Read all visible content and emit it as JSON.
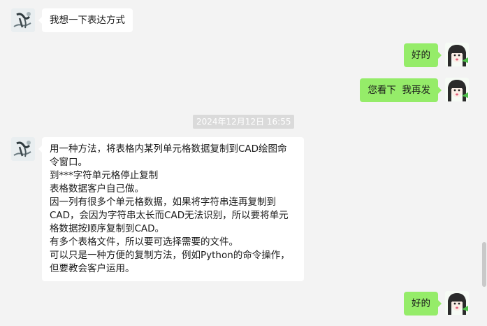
{
  "messages": [
    {
      "side": "in",
      "text": "我想一下表达方式"
    },
    {
      "side": "out",
      "text": "好的"
    },
    {
      "side": "out",
      "text": "您看下  我再发"
    },
    {
      "side": "in",
      "lines": [
        "用一种方法，将表格内某列单元格数据复制到CAD绘图命",
        "令窗口。",
        "到***字符单元格停止复制",
        "表格数据客户自己做。",
        "因一列有很多个单元格数据，如果将字符串连再复制到",
        "CAD，会因为字符串太长而CAD无法识别，所以要将单元",
        "格数据按顺序复制到CAD。",
        "有多个表格文件，所以要可选择需要的文件。",
        "可以只是一种方便的复制方法，例如Python的命令操作，",
        "但要教会客户运用。"
      ]
    },
    {
      "side": "out",
      "text": "好的"
    }
  ],
  "timestamp": "2024年12月12日 16:55",
  "colors": {
    "background": "#f3f3f3",
    "incoming_bubble": "#ffffff",
    "outgoing_bubble": "#95ec69",
    "timestamp_bg": "#dadada"
  },
  "avatars": {
    "contact": "ink-painting-avatar",
    "self": "anime-girl-avatar"
  }
}
